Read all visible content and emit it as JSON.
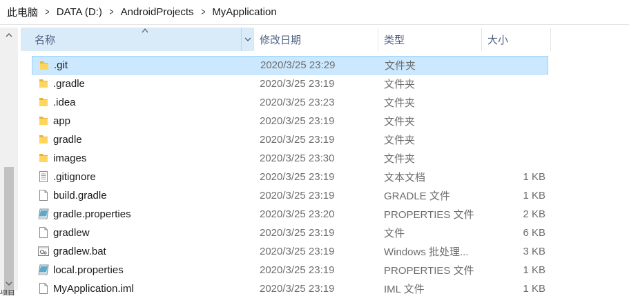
{
  "breadcrumb": [
    "此电脑",
    "DATA (D:)",
    "AndroidProjects",
    "MyApplication"
  ],
  "breadcrumb_sep": ">",
  "columns": {
    "name": "名称",
    "date": "修改日期",
    "type": "类型",
    "size": "大小"
  },
  "sort_indicator": "^",
  "scroll": {
    "up": "^",
    "down": "v"
  },
  "files": [
    {
      "name": ".git",
      "date": "2020/3/25 23:29",
      "type": "文件夹",
      "size": "",
      "icon": "folder-icon",
      "selected": true
    },
    {
      "name": ".gradle",
      "date": "2020/3/25 23:19",
      "type": "文件夹",
      "size": "",
      "icon": "folder-icon"
    },
    {
      "name": ".idea",
      "date": "2020/3/25 23:23",
      "type": "文件夹",
      "size": "",
      "icon": "folder-icon"
    },
    {
      "name": "app",
      "date": "2020/3/25 23:19",
      "type": "文件夹",
      "size": "",
      "icon": "folder-icon"
    },
    {
      "name": "gradle",
      "date": "2020/3/25 23:19",
      "type": "文件夹",
      "size": "",
      "icon": "folder-icon"
    },
    {
      "name": "images",
      "date": "2020/3/25 23:30",
      "type": "文件夹",
      "size": "",
      "icon": "folder-icon"
    },
    {
      "name": ".gitignore",
      "date": "2020/3/25 23:19",
      "type": "文本文档",
      "size": "1 KB",
      "icon": "text-file-icon"
    },
    {
      "name": "build.gradle",
      "date": "2020/3/25 23:19",
      "type": "GRADLE 文件",
      "size": "1 KB",
      "icon": "blank-file-icon"
    },
    {
      "name": "gradle.properties",
      "date": "2020/3/25 23:20",
      "type": "PROPERTIES 文件",
      "size": "2 KB",
      "icon": "properties-file-icon"
    },
    {
      "name": "gradlew",
      "date": "2020/3/25 23:19",
      "type": "文件",
      "size": "6 KB",
      "icon": "blank-file-icon"
    },
    {
      "name": "gradlew.bat",
      "date": "2020/3/25 23:19",
      "type": "Windows 批处理...",
      "size": "3 KB",
      "icon": "batch-file-icon"
    },
    {
      "name": "local.properties",
      "date": "2020/3/25 23:19",
      "type": "PROPERTIES 文件",
      "size": "1 KB",
      "icon": "properties-file-icon"
    },
    {
      "name": "MyApplication.iml",
      "date": "2020/3/25 23:19",
      "type": "IML 文件",
      "size": "1 KB",
      "icon": "blank-file-icon"
    }
  ],
  "status_fragment": "项目"
}
